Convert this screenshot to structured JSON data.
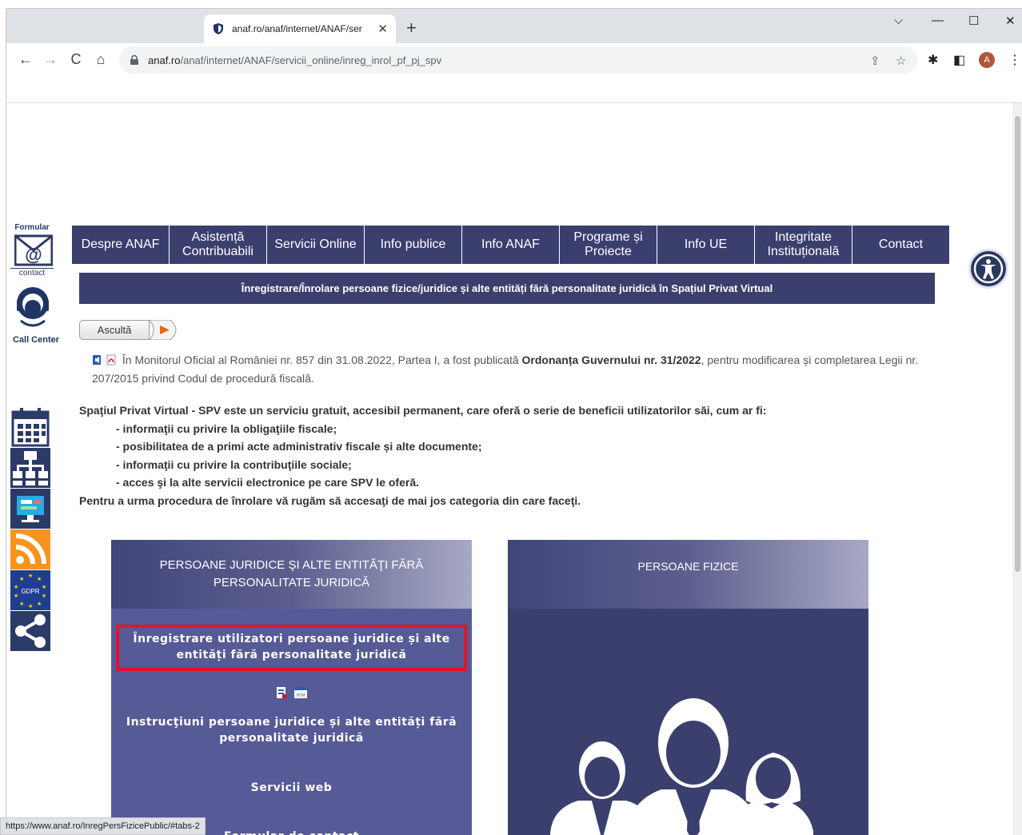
{
  "browser": {
    "tab_title": "anaf.ro/anaf/internet/ANAF/ser",
    "url_host": "anaf.ro",
    "url_path": "/anaf/internet/ANAF/servicii_online/inreg_inrol_pf_pj_spv",
    "avatar_letter": "A",
    "status_url": "https://www.anaf.ro/InregPersFizicePublic/#tabs-2"
  },
  "rail": {
    "formular_label": "Formular",
    "contact_label": "contact",
    "callcenter_label": "Call Center"
  },
  "menu": [
    {
      "label": "Despre ANAF"
    },
    {
      "label": "Asistență Contribuabili"
    },
    {
      "label": "Servicii Online"
    },
    {
      "label": "Info publice"
    },
    {
      "label": "Info ANAF"
    },
    {
      "label": "Programe și Proiecte"
    },
    {
      "label": "Info UE"
    },
    {
      "label": "Integritate Instituțională"
    },
    {
      "label": "Contact"
    }
  ],
  "page_title": "Înregistrare/Înrolare persoane fizice/juridice și alte entități fără personalitate juridică în Spațiul Privat Virtual",
  "asculta_label": "Ascultă",
  "notice": {
    "text_before": "În Monitorul Oficial al României nr. 857 din 31.08.2022, Partea I, a fost publicată ",
    "bold": "Ordonanța Guvernului nr. 31/2022",
    "text_after": ", pentru modificarea și completarea Legii nr. 207/2015 privind Codul de procedură fiscală."
  },
  "intro": {
    "lead": "Spaţiul Privat Virtual - SPV este un serviciu gratuit, accesibil permanent, care oferă o serie de beneficii utilizatorilor săi, cum ar fi:",
    "items": [
      "- informaţii cu privire la obligaţiile fiscale;",
      "- posibilitatea de a primi acte administrativ fiscale și alte documente;",
      "- informaţii cu privire la contribuţiile sociale;",
      "- acces şi la alte servicii electronice pe care SPV le oferă."
    ],
    "closing": "Pentru a urma procedura de înrolare vă rugăm să accesaţi de mai jos categoria din care faceţi."
  },
  "card_pj": {
    "title": "PERSOANE JURIDICE ŞI ALTE ENTITĂŢI FĂRĂ PERSONALITATE JURIDICĂ",
    "register": "Înregistrare utilizatori persoane juridice și alte entități fără personalitate juridică",
    "instructions": "Instrucţiuni persoane juridice și alte entități fără personalitate juridică",
    "webservices": "Servicii web",
    "contact_form": "Formular de contact"
  },
  "card_pf": {
    "title": "PERSOANE FIZICE"
  },
  "colors": {
    "menu_bg": "#3b3f6e",
    "card_pj_body": "#565a96",
    "highlight_border": "#e1132a"
  }
}
